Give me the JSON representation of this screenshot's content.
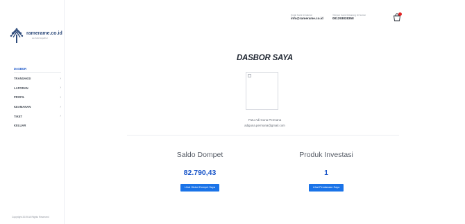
{
  "brand": {
    "name": "ramerame.co.id",
    "tagline": "we build together"
  },
  "sidebar": {
    "items": [
      {
        "label": "DASBOR",
        "active": true,
        "has_chevron": false
      },
      {
        "label": "TRANSAKSI",
        "active": false,
        "has_chevron": true
      },
      {
        "label": "LAPORAN",
        "active": false,
        "has_chevron": true
      },
      {
        "label": "PROFIL",
        "active": false,
        "has_chevron": true
      },
      {
        "label": "KEAMANAN",
        "active": false,
        "has_chevron": true
      },
      {
        "label": "TIKET",
        "active": false,
        "has_chevron": true
      },
      {
        "label": "KELUAR",
        "active": false,
        "has_chevron": false
      }
    ],
    "chevron": "›",
    "copyright": "Copyright 2019 All Rights Reserved"
  },
  "header": {
    "email_label": "Email Kami Di Alamat",
    "email_value": "info@ramerame.co.id",
    "phone_label": "Telepon Kami Sekarang Di Nomor",
    "phone_value": "081293838358",
    "cart_icon": "cart-icon"
  },
  "main": {
    "title": "DASBOR SAYA",
    "profile": {
      "name": "Putu Adi Guna Permana",
      "email": "adiguna.permana@gmail.com"
    },
    "wallet": {
      "label": "Saldo Dompet",
      "value": "82.790,43",
      "button": "Lihat Histori Dompet Saya"
    },
    "investment": {
      "label": "Produk Investasi",
      "value": "1",
      "button": "Lihat Pendanaan Saya"
    }
  },
  "colors": {
    "accent": "#1a56c9",
    "button": "#1a73e8",
    "cart_badge": "#e02424",
    "brand_text": "#2d4a7a"
  }
}
